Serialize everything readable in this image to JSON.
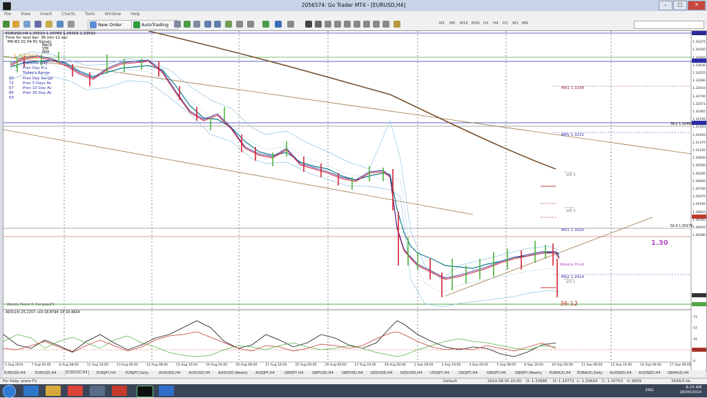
{
  "window": {
    "title": "2056574: Go Trader MT4 - [EURUSD,H4]"
  },
  "menu": [
    "File",
    "View",
    "Insert",
    "Charts",
    "Tools",
    "Window",
    "Help"
  ],
  "toolbar": {
    "new_order": "New Order",
    "autotrading": "AutoTrading",
    "timeframes": [
      "M1",
      "M5",
      "M15",
      "M30",
      "H1",
      "H4",
      "D1",
      "W1",
      "MN"
    ]
  },
  "chart": {
    "header": "EURUSD,H4  1.29510 1.29783 1.29316 1.29592",
    "timer": "Time for next bar: 36 min 12 sec",
    "legend_headers": [
      "MN",
      "W1",
      "D1",
      "H4",
      "H1",
      "Signals"
    ],
    "legend_items": [
      "MACD",
      "STR",
      "EMA"
    ],
    "big_price": "1.58702",
    "range_values": [
      "80",
      "72",
      "67",
      "85",
      "63"
    ],
    "range_labels": [
      "Previous Day",
      "Prev Day H-L",
      "Today's Range",
      "Prev Day Range",
      "Prev 5 Days Av",
      "Prev 10 Day Av",
      "Prev 30 Day Av"
    ],
    "footer_label": "Weekly Pivots © CompassFX",
    "countdown": "36:12",
    "big_level": "1.30",
    "pivot_labels": [
      {
        "text": "MR1  1.3338",
        "color": "#8b1a3a"
      },
      {
        "text": "MPV  1.3232",
        "color": "#2b2ba8"
      },
      {
        "text": "wR 3",
        "color": "#7f7f7f"
      },
      {
        "text": "wR 2",
        "color": "#7f7f7f"
      },
      {
        "text": "MS1  1.3020",
        "color": "#2b2ba8"
      },
      {
        "text": "Weekly Pivot",
        "color": "#b04fc0"
      },
      {
        "text": "MS2  1.2914",
        "color": "#2b2ba8"
      },
      {
        "text": "wS 1",
        "color": "#7f7f7f"
      }
    ],
    "fib_labels": [
      "38.2  1.32483",
      "50.0  1.30179"
    ],
    "price_axis": [
      "1.34641",
      "1.34375",
      "1.34100",
      "1.33945",
      "1.33830",
      "1.33555",
      "1.33280",
      "1.33010",
      "1.32740",
      "1.32571",
      "1.32465",
      "1.32195",
      "1.31920",
      "1.31650",
      "1.31375",
      "1.31105",
      "1.30830",
      "1.30560",
      "1.30285",
      "1.30000",
      "1.29740",
      "1.29470",
      "1.29195",
      "1.28925",
      "1.28782",
      "1.28650",
      "1.28380"
    ],
    "time_axis": [
      "5 Aug 2014",
      "7 Aug 00:00",
      "8 Aug 08:00",
      "11 Aug 16:00",
      "13 Aug 00:00",
      "14 Aug 08:00",
      "15 Aug 16:00",
      "19 Aug 00:00",
      "20 Aug 08:00",
      "21 Aug 16:00",
      "25 Aug 00:00",
      "26 Aug 08:00",
      "27 Aug 16:00",
      "29 Aug 00:00",
      "1 Sep 08:00",
      "2 Sep 16:00",
      "4 Sep 00:00",
      "5 Sep 08:00",
      "8 Sep 16:00",
      "10 Sep 00:00",
      "11 Sep 08:00",
      "12 Sep 16:00",
      "16 Sep 00:00",
      "17 Sep 08:00"
    ],
    "adx_header": "ADX(14) 25.2157 +DI 18.8794 -DI 20.4834",
    "adx_axis": [
      "73",
      "57",
      "41",
      "25.0000",
      "9"
    ]
  },
  "tabs": [
    "EURUSD,H4",
    "EURUSD,H4",
    "EURUSD,H4",
    "EURJPY,H4",
    "EURJPY,Daily",
    "AUDUSD,H4",
    "AUDUSD,H4",
    "AUDUSD,Weekly",
    "AUDJPY,H4",
    "GBPJPY,H4",
    "GBPUSD,H4",
    "GBPUSD,H4",
    "NZDUSD,H4",
    "NZDUSD,H4",
    "USDJPY,H4",
    "USDJPY,H4",
    "GBPJPY,H4",
    "GBPJPY,Weekly",
    "EURAUD,H4",
    "EURAUD,Daily",
    "AUDNZD,H4",
    "AUDNZD,H4",
    "GBPAUD,H4"
  ],
  "status": {
    "help": "For Help, press F1",
    "profile": "Default",
    "datetime": "2014.08.05 20:00",
    "o": "O: 1.33686",
    "h": "H: 1.33772",
    "l": "L: 1.33624",
    "c": "C: 1.33753",
    "v": "V: 9839",
    "traffic": "3439/3 kb"
  },
  "taskbar": {
    "lang": "ENG",
    "time": "8:23 AM",
    "date": "18/09/2014"
  }
}
